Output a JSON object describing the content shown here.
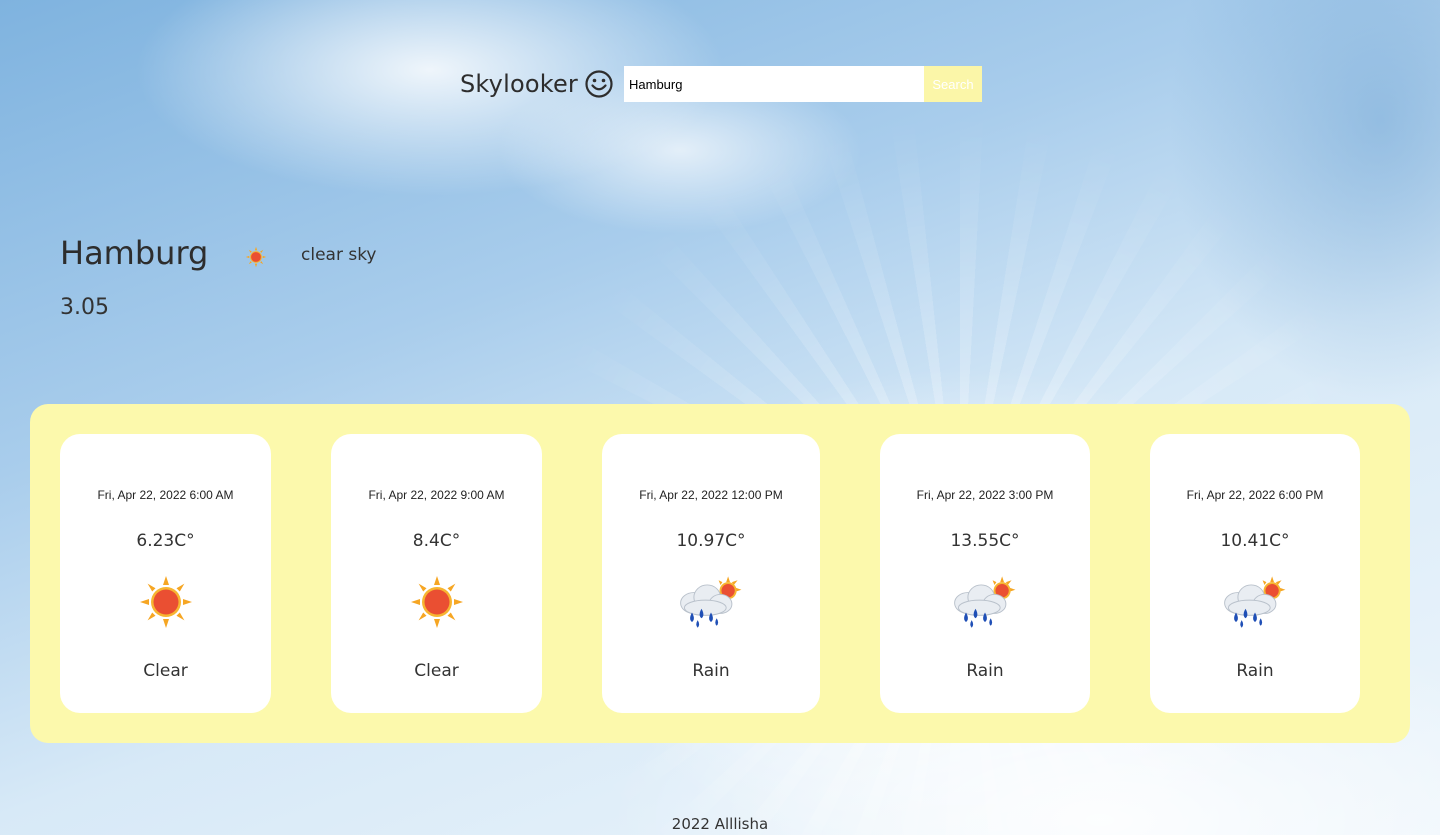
{
  "header": {
    "brand": "Skylooker",
    "brand_icon": "smiley-face-icon",
    "search_value": "Hamburg",
    "search_button": "Search"
  },
  "current": {
    "city": "Hamburg",
    "icon": "sun-icon",
    "description": "clear sky",
    "temperature": "3.05"
  },
  "forecast": [
    {
      "date": "Fri, Apr 22, 2022 6:00 AM",
      "temp": "6.23C°",
      "icon": "sun-icon",
      "desc": "Clear"
    },
    {
      "date": "Fri, Apr 22, 2022 9:00 AM",
      "temp": "8.4C°",
      "icon": "sun-icon",
      "desc": "Clear"
    },
    {
      "date": "Fri, Apr 22, 2022 12:00 PM",
      "temp": "10.97C°",
      "icon": "rain-cloud-sun-icon",
      "desc": "Rain"
    },
    {
      "date": "Fri, Apr 22, 2022 3:00 PM",
      "temp": "13.55C°",
      "icon": "rain-cloud-sun-icon",
      "desc": "Rain"
    },
    {
      "date": "Fri, Apr 22, 2022 6:00 PM",
      "temp": "10.41C°",
      "icon": "rain-cloud-sun-icon",
      "desc": "Rain"
    }
  ],
  "footer": "2022 Alllisha",
  "colors": {
    "forecast_panel": "#fcf9ac",
    "search_button": "#fbf6a8",
    "card": "#ffffff"
  }
}
